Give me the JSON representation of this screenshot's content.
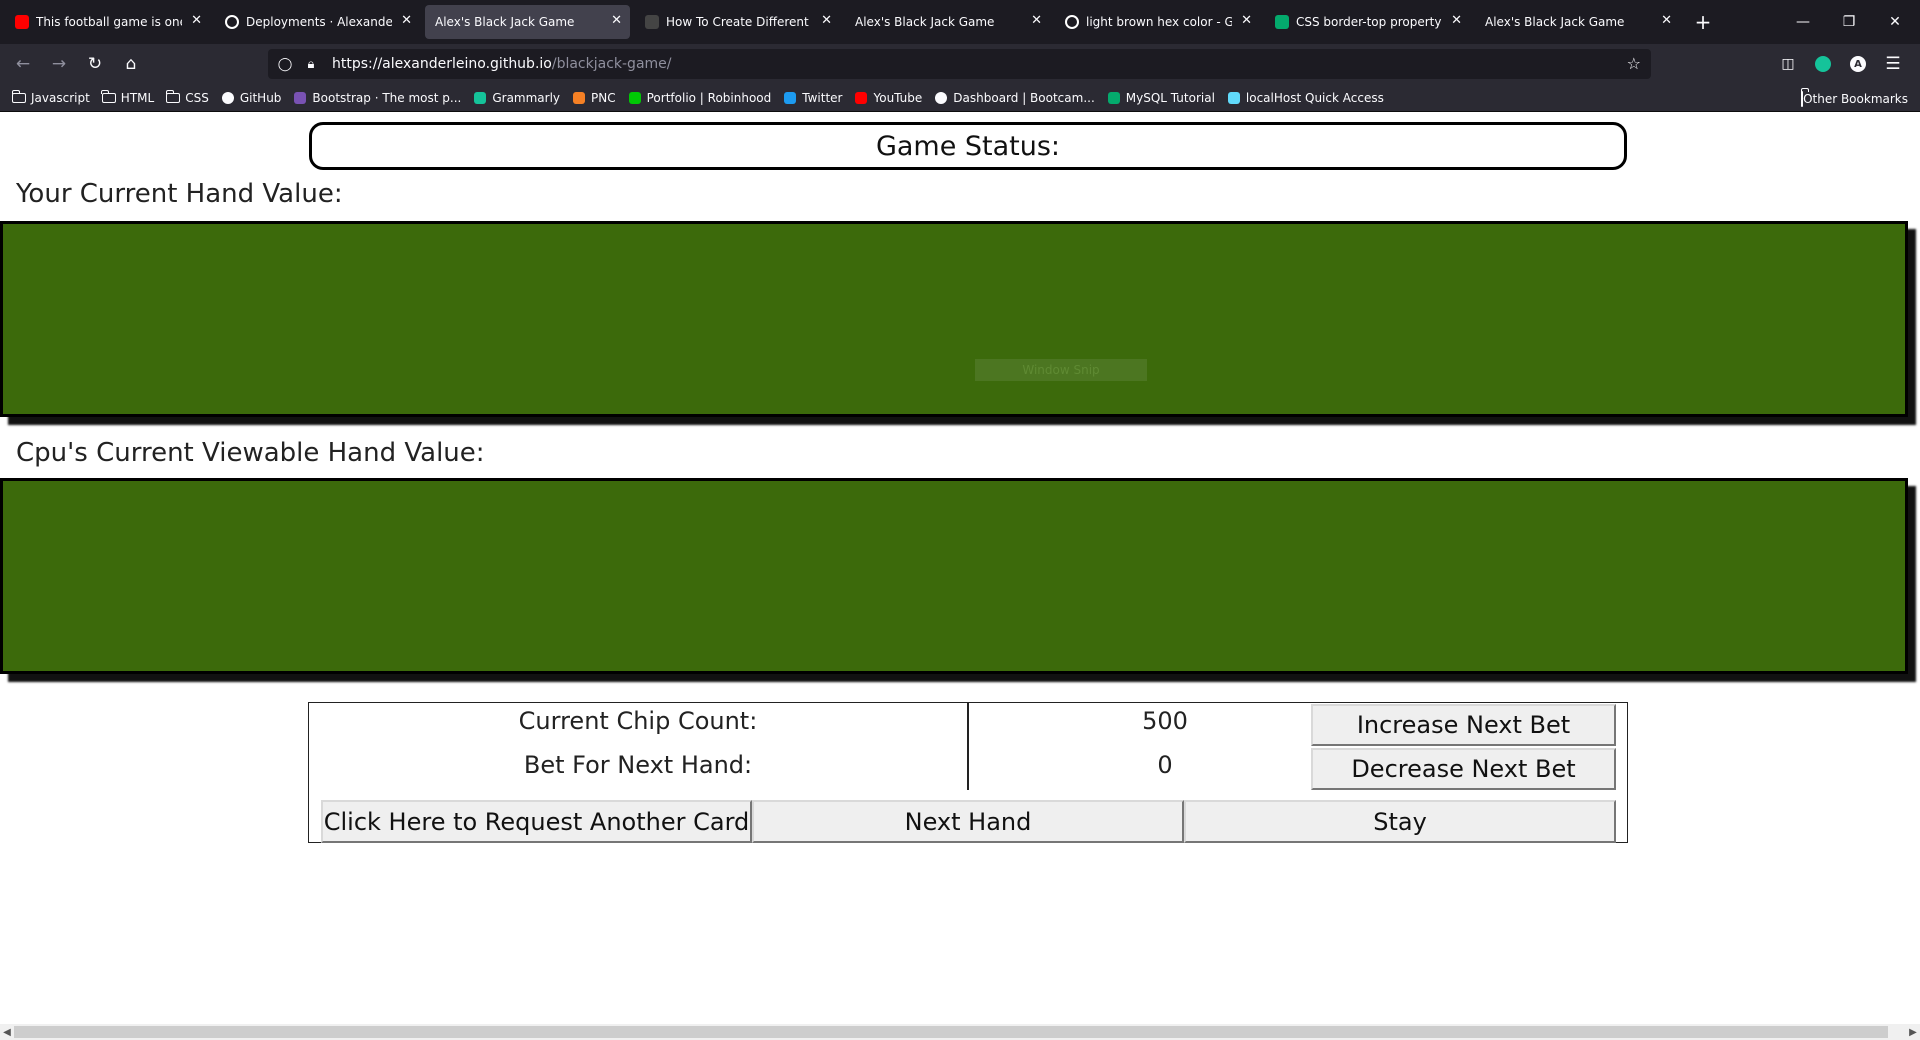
{
  "browser": {
    "tabs": [
      {
        "title": "This football game is one of a",
        "icon": "youtube-icon",
        "color": "#ff0000",
        "active": false
      },
      {
        "title": "Deployments · AlexanderLein",
        "icon": "github-icon",
        "color": "#ffffff",
        "active": false
      },
      {
        "title": "Alex's Black Jack Game",
        "icon": "",
        "color": "",
        "active": true
      },
      {
        "title": "How To Create Different Shap",
        "icon": "p-icon",
        "color": "#444444",
        "active": false
      },
      {
        "title": "Alex's Black Jack Game",
        "icon": "",
        "color": "",
        "active": false
      },
      {
        "title": "light brown hex color - Googl",
        "icon": "google-icon",
        "color": "#ffffff",
        "active": false
      },
      {
        "title": "CSS border-top property",
        "icon": "w3schools-icon",
        "color": "#04aa6d",
        "active": false
      },
      {
        "title": "Alex's Black Jack Game",
        "icon": "",
        "color": "",
        "active": false
      }
    ],
    "url_host": "https://alexanderleino.github.io",
    "url_path": "/blackjack-game/",
    "bookmarks": [
      {
        "label": "Javascript",
        "icon": "folder-icon"
      },
      {
        "label": "HTML",
        "icon": "folder-icon"
      },
      {
        "label": "CSS",
        "icon": "folder-icon"
      },
      {
        "label": "GitHub",
        "icon": "github-icon"
      },
      {
        "label": "Bootstrap · The most p...",
        "icon": "bootstrap-icon"
      },
      {
        "label": "Grammarly",
        "icon": "grammarly-icon"
      },
      {
        "label": "PNC",
        "icon": "pnc-icon"
      },
      {
        "label": "Portfolio | Robinhood",
        "icon": "robinhood-icon"
      },
      {
        "label": "Twitter",
        "icon": "twitter-icon"
      },
      {
        "label": "YouTube",
        "icon": "youtube-icon"
      },
      {
        "label": "Dashboard | Bootcam...",
        "icon": "globe-icon"
      },
      {
        "label": "MySQL Tutorial",
        "icon": "w3schools-icon"
      },
      {
        "label": "localHost Quick Access",
        "icon": "react-icon"
      }
    ],
    "other_bookmarks": "Other Bookmarks"
  },
  "game": {
    "status_label": "Game Status:",
    "player_label": "Your Current Hand Value:",
    "cpu_label": "Cpu's Current Viewable Hand Value:",
    "table_color": "#3c6a0b",
    "overlay_text": "Window Snip",
    "chip_count_label": "Current Chip Count:",
    "chip_count_value": "500",
    "bet_label": "Bet For Next Hand:",
    "bet_value": "0",
    "increase_bet": "Increase Next Bet",
    "decrease_bet": "Decrease Next Bet",
    "hit_button": "Click Here to Request Another Card",
    "next_hand_button": "Next Hand",
    "stay_button": "Stay"
  }
}
